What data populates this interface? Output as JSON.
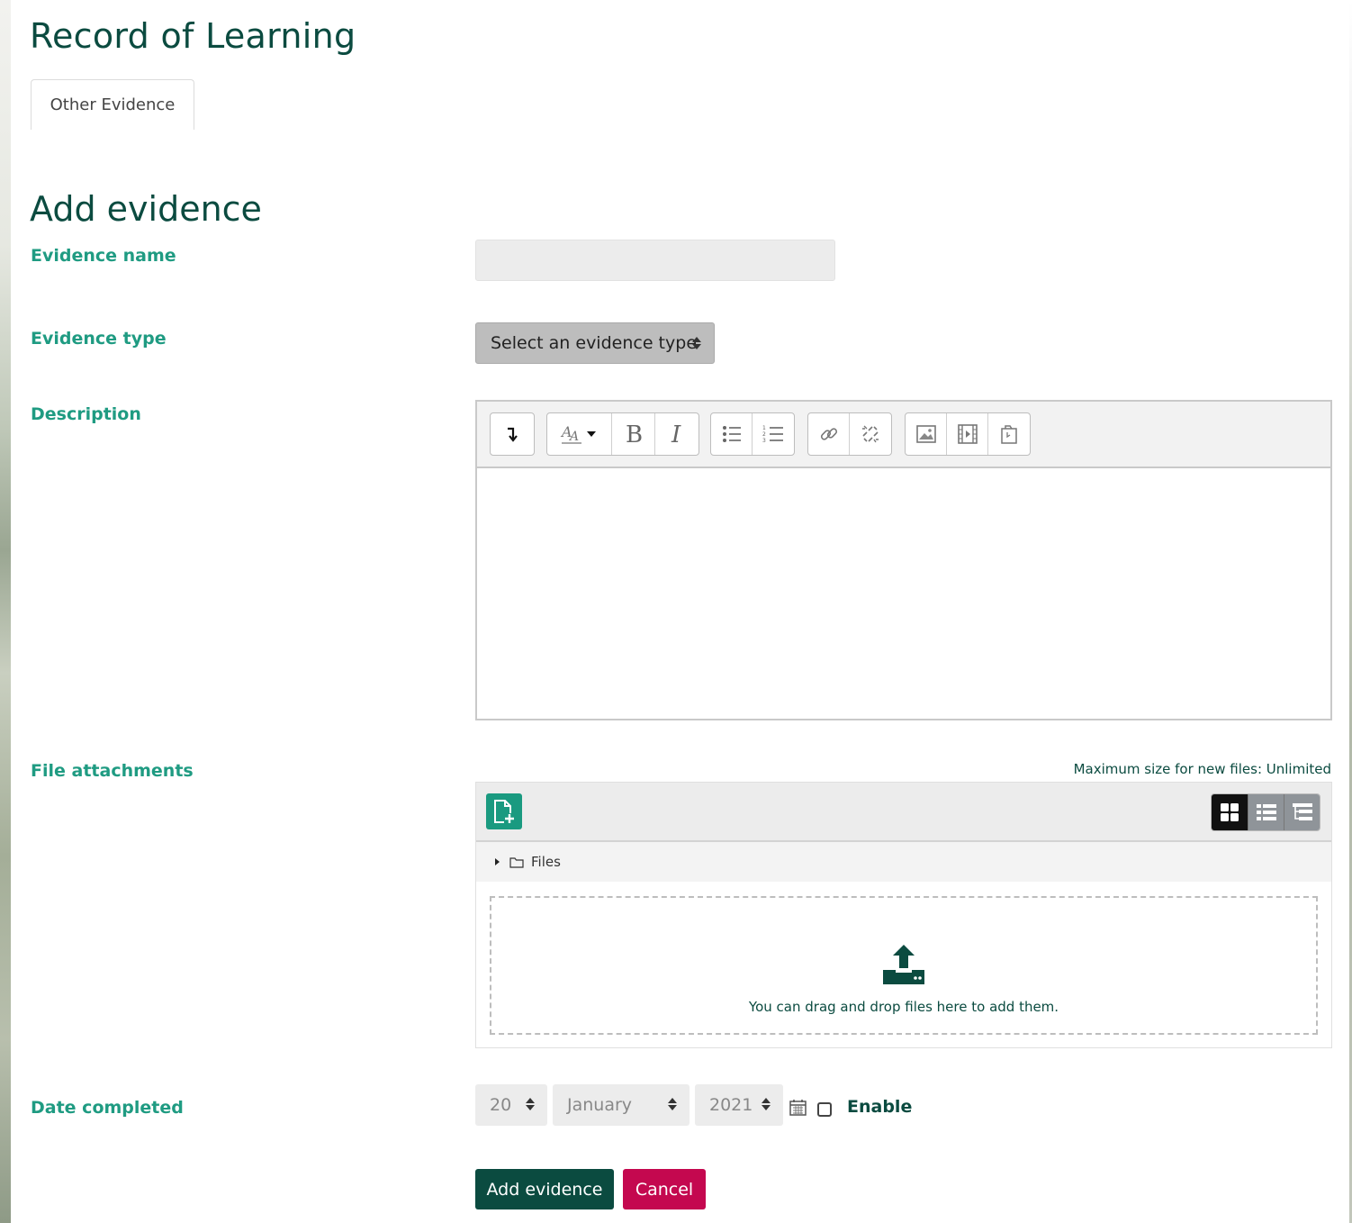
{
  "page": {
    "title": "Record of Learning"
  },
  "tabs": [
    {
      "label": "Other Evidence"
    }
  ],
  "form": {
    "heading": "Add evidence",
    "evidence_name": {
      "label": "Evidence name",
      "value": ""
    },
    "evidence_type": {
      "label": "Evidence type",
      "selected": "Select an evidence type"
    },
    "description": {
      "label": "Description",
      "value": ""
    },
    "file_attachments": {
      "label": "File attachments",
      "max_size_text": "Maximum size for new files: Unlimited",
      "folder_label": "Files",
      "drop_text": "You can drag and drop files here to add them."
    },
    "date_completed": {
      "label": "Date completed",
      "day": "20",
      "month": "January",
      "year": "2021",
      "enable_label": "Enable",
      "enabled": false
    },
    "buttons": {
      "submit": "Add evidence",
      "cancel": "Cancel"
    }
  },
  "editor_toolbar": [
    "collapse-icon",
    "paragraph-styles-icon",
    "bold-icon",
    "italic-icon",
    "unordered-list-icon",
    "ordered-list-icon",
    "link-icon",
    "unlink-icon",
    "image-icon",
    "media-icon",
    "manage-files-icon"
  ],
  "colors": {
    "heading": "#0b4b40",
    "label": "#1f9b82",
    "primary": "#0b4b40",
    "cancel": "#c4084f",
    "accent": "#1a9a80"
  }
}
